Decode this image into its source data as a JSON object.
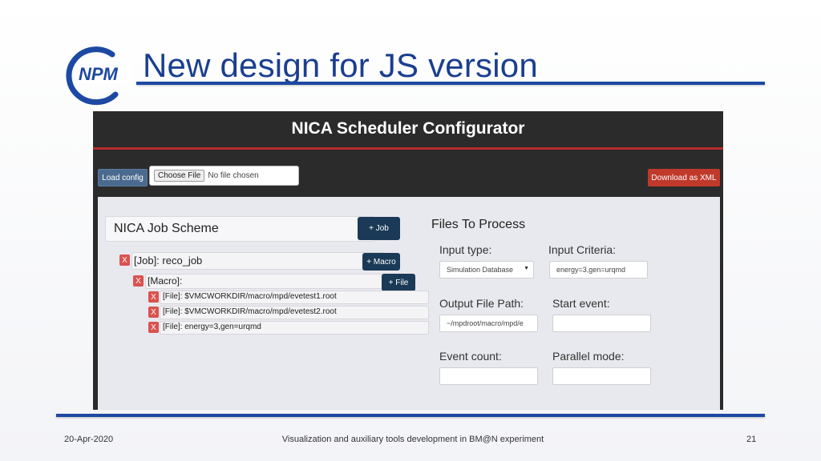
{
  "slide": {
    "logo_text": "NPM",
    "title": "New design for JS version",
    "footer": {
      "date": "20-Apr-2020",
      "center": "Visualization and auxiliary tools development in BM@N experiment",
      "page": "21"
    }
  },
  "app": {
    "title": "NICA Scheduler Configurator",
    "toolbar": {
      "load_config_label": "Load config",
      "choose_file_label": "Choose File",
      "file_status": "No file chosen",
      "download_label": "Download as XML"
    },
    "scheme": {
      "title": "NICA Job Scheme",
      "add_job_label": "+ Job",
      "job": {
        "remove_label": "X",
        "label": "[Job]: reco_job",
        "add_macro_label": "+ Macro"
      },
      "macro": {
        "remove_label": "X",
        "label": "[Macro]:",
        "add_file_label": "+ File"
      },
      "files": [
        {
          "remove_label": "X",
          "label": "[File]: $VMCWORKDIR/macro/mpd/evetest1.root"
        },
        {
          "remove_label": "X",
          "label": "[File]: $VMCWORKDIR/macro/mpd/evetest2.root"
        },
        {
          "remove_label": "X",
          "label": "[File]: energy=3,gen=urqmd"
        }
      ]
    },
    "files_to_process": {
      "title": "Files To Process",
      "input_type": {
        "label": "Input type:",
        "value": "Simulation Database"
      },
      "input_criteria": {
        "label": "Input Criteria:",
        "value": "energy=3,gen=urqmd"
      },
      "output_path": {
        "label": "Output File Path:",
        "value": "~/mpdroot/macro/mpd/e"
      },
      "start_event": {
        "label": "Start event:",
        "value": ""
      },
      "event_count": {
        "label": "Event count:",
        "value": ""
      },
      "parallel_mode": {
        "label": "Parallel mode:",
        "value": ""
      }
    }
  },
  "colors": {
    "title_blue": "#1b3f8f",
    "rule_blue": "#1d49a3",
    "header_dark": "#2b2b2b",
    "accent_red": "#c0392b",
    "button_navy": "#1b3a57"
  }
}
